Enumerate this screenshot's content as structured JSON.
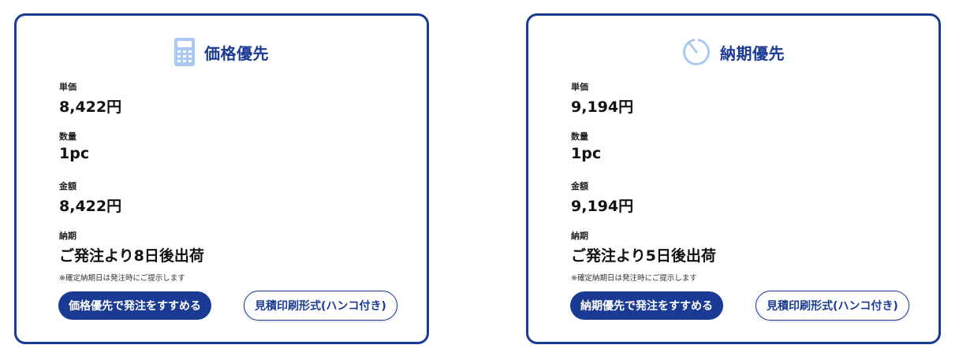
{
  "colors": {
    "accent": "#1b3a94",
    "icon_fill": "#a9c8f2"
  },
  "cards": [
    {
      "icon": "calculator-icon",
      "title": "価格優先",
      "fields": [
        {
          "label": "単価",
          "value": "8,422円"
        },
        {
          "label": "数量",
          "value": "1pc"
        },
        {
          "label": "金額",
          "value": "8,422円"
        },
        {
          "label": "納期",
          "value": "ご発注より8日後出荷"
        }
      ],
      "note": "※確定納期日は発注時にご提示します",
      "primary_button": "価格優先で発注をすすめる",
      "secondary_button": "見積印刷形式(ハンコ付き)"
    },
    {
      "icon": "timer-icon",
      "title": "納期優先",
      "fields": [
        {
          "label": "単価",
          "value": "9,194円"
        },
        {
          "label": "数量",
          "value": "1pc"
        },
        {
          "label": "金額",
          "value": "9,194円"
        },
        {
          "label": "納期",
          "value": "ご発注より5日後出荷"
        }
      ],
      "note": "※確定納期日は発注時にご提示します",
      "primary_button": "納期優先で発注をすすめる",
      "secondary_button": "見積印刷形式(ハンコ付き)"
    }
  ]
}
